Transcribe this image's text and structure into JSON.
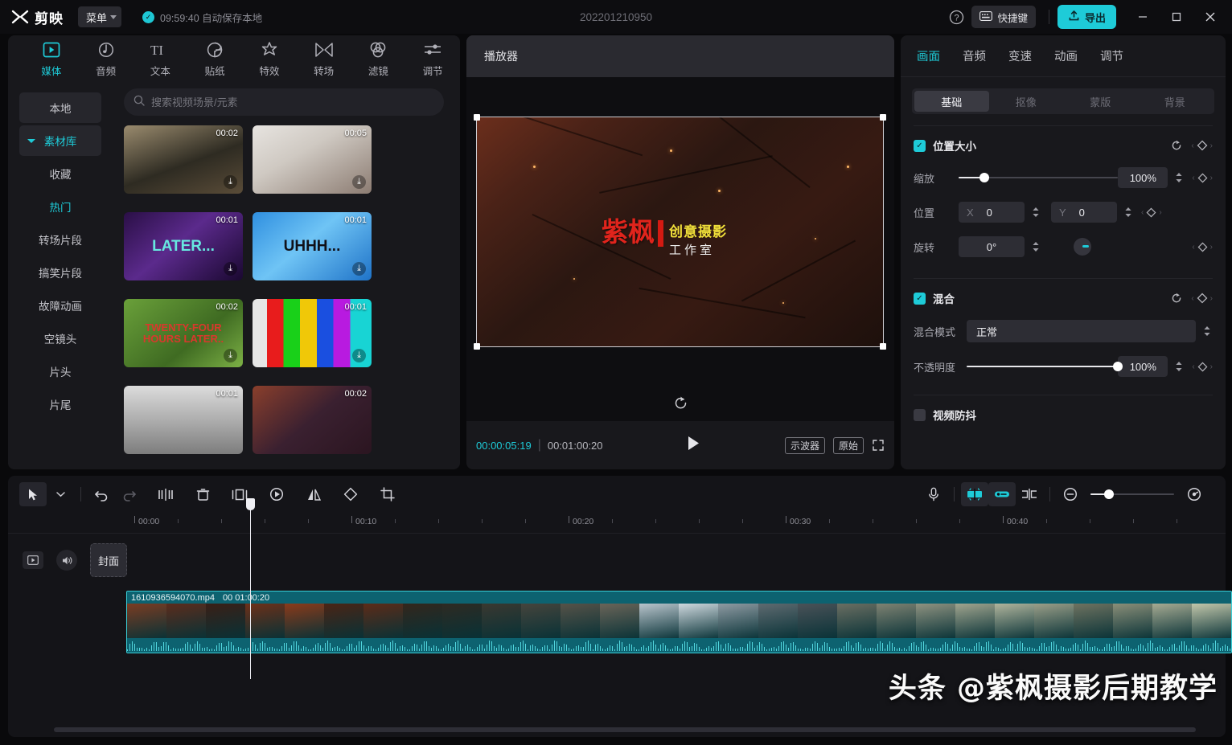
{
  "titlebar": {
    "app_name": "剪映",
    "menu_label": "菜单",
    "autosave_text": "09:59:40 自动保存本地",
    "project_title": "202201210950",
    "help_icon": "question-circle-icon",
    "shortcut_label": "快捷键",
    "export_label": "导出",
    "minimize": "—",
    "maximize": "□",
    "close": "✕",
    "accent_color": "#1ecbd8"
  },
  "left_panel": {
    "tabs": [
      {
        "label": "媒体",
        "icon": "media-icon",
        "active": true
      },
      {
        "label": "音频",
        "icon": "audio-icon",
        "active": false
      },
      {
        "label": "文本",
        "icon": "text-icon",
        "active": false
      },
      {
        "label": "贴纸",
        "icon": "sticker-icon",
        "active": false
      },
      {
        "label": "特效",
        "icon": "effects-icon",
        "active": false
      },
      {
        "label": "转场",
        "icon": "transition-icon",
        "active": false
      },
      {
        "label": "滤镜",
        "icon": "filter-icon",
        "active": false
      },
      {
        "label": "调节",
        "icon": "adjust-icon",
        "active": false
      }
    ],
    "sidebar": [
      {
        "label": "本地",
        "style": "box"
      },
      {
        "label": "素材库",
        "style": "box-accent-expanded"
      },
      {
        "label": "收藏",
        "style": "plain"
      },
      {
        "label": "热门",
        "style": "accent"
      },
      {
        "label": "转场片段",
        "style": "plain"
      },
      {
        "label": "搞笑片段",
        "style": "plain"
      },
      {
        "label": "故障动画",
        "style": "plain"
      },
      {
        "label": "空镜头",
        "style": "plain"
      },
      {
        "label": "片头",
        "style": "plain"
      },
      {
        "label": "片尾",
        "style": "plain"
      }
    ],
    "search_placeholder": "搜索视频场景/元素",
    "search_value": "",
    "search_icon": "search-icon",
    "thumbnails": [
      {
        "duration": "00:02",
        "caption": "",
        "bg": "linear-gradient(160deg,#9a8b6e,#2e2b22 55%,#5a4c38)"
      },
      {
        "duration": "00:05",
        "caption": "",
        "bg": "linear-gradient(150deg,#e7e4e0,#cfc9c2 40%,#8c7c72)"
      },
      {
        "duration": "00:01",
        "caption": "LATER...",
        "cap_color": "#67e8e0",
        "bg": "linear-gradient(140deg,#2a0f46,#5b2a8c 45%,#1a0830)"
      },
      {
        "duration": "00:01",
        "caption": "UHHH...",
        "cap_color": "#101018",
        "bg": "linear-gradient(140deg,#2f8fe0,#6fc4f5 45%,#1f73c8)"
      },
      {
        "duration": "00:02",
        "caption": "TWENTY-FOUR HOURS LATER..",
        "cap_color": "#d9382c",
        "bg": "linear-gradient(140deg,#6aa03a,#3f6b22 60%,#7cb045)"
      },
      {
        "duration": "00:01",
        "caption": "",
        "bg": "linear-gradient(90deg,#e6e6e6 0 12%,#e81c1c 12% 26%,#19d019 26% 40%,#f0c808 40% 54%,#1a4fe0 54% 68%,#b81ae0 68% 82%,#18d4d4 82% 100%)"
      },
      {
        "duration": "00:01",
        "caption": "",
        "bg": "linear-gradient(180deg,#dcdcdc,#a9a9a9 55%,#7d7d7d)"
      },
      {
        "duration": "00:02",
        "caption": "",
        "bg": "linear-gradient(140deg,#8a3f2c,#3a2030 50%,#2b1520)"
      }
    ]
  },
  "player": {
    "header": "播放器",
    "watermark_left": "紫枫",
    "watermark_line1": "创意摄影",
    "watermark_line2": "工作室",
    "watermark_left_color": "#e0241c",
    "watermark_line1_color": "#f1e03a",
    "reset_icon": "reset-rotate-icon",
    "current_time": "00:00:05:19",
    "total_time": "00:01:00:20",
    "play_icon": "play-icon",
    "scope_label": "示波器",
    "original_label": "原始",
    "fullscreen_icon": "fullscreen-icon"
  },
  "right_panel": {
    "tabs": [
      {
        "label": "画面",
        "active": true
      },
      {
        "label": "音频",
        "active": false
      },
      {
        "label": "变速",
        "active": false
      },
      {
        "label": "动画",
        "active": false
      },
      {
        "label": "调节",
        "active": false
      }
    ],
    "segments": [
      {
        "label": "基础",
        "active": true
      },
      {
        "label": "抠像",
        "active": false
      },
      {
        "label": "蒙版",
        "active": false
      },
      {
        "label": "背景",
        "active": false
      }
    ],
    "position_size": {
      "title": "位置大小",
      "checked": true,
      "reset_icon": "reset-icon",
      "keyframe_icon": "keyframe-diamond-icon",
      "scale_label": "缩放",
      "scale_value": "100%",
      "scale_percent": 16,
      "position_label": "位置",
      "pos_x_axis": "X",
      "pos_x_value": "0",
      "pos_y_axis": "Y",
      "pos_y_value": "0",
      "rotate_label": "旋转",
      "rotate_value": "0°"
    },
    "blend": {
      "title": "混合",
      "checked": true,
      "mode_label": "混合模式",
      "mode_value": "正常",
      "opacity_label": "不透明度",
      "opacity_value": "100%",
      "opacity_percent": 100
    },
    "stabilize": {
      "title": "视频防抖",
      "checked": false
    }
  },
  "timeline": {
    "tools": [
      {
        "name": "select-arrow-icon",
        "state": "normal"
      },
      {
        "name": "chevron-down-icon",
        "state": "normal"
      },
      {
        "name": "undo-icon",
        "state": "normal"
      },
      {
        "name": "redo-icon",
        "state": "dim"
      },
      {
        "name": "split-icon",
        "state": "normal"
      },
      {
        "name": "delete-icon",
        "state": "normal"
      },
      {
        "name": "freeze-frame-icon",
        "state": "normal"
      },
      {
        "name": "reverse-icon",
        "state": "normal"
      },
      {
        "name": "mirror-icon",
        "state": "normal"
      },
      {
        "name": "rotate-icon",
        "state": "normal"
      },
      {
        "name": "crop-icon",
        "state": "normal"
      }
    ],
    "right_tools": [
      {
        "name": "microphone-icon",
        "state": "normal"
      },
      {
        "name": "auto-snap-icon",
        "state": "on"
      },
      {
        "name": "link-icon",
        "state": "on"
      },
      {
        "name": "adjust-clip-icon",
        "state": "normal"
      },
      {
        "name": "zoom-out-icon",
        "state": "normal"
      },
      {
        "name": "zoom-in-icon",
        "state": "normal"
      }
    ],
    "zoom_percent": 22,
    "ruler_labels": [
      "00:00",
      "00:10",
      "00:20",
      "00:30",
      "00:40"
    ],
    "playhead_time": "00:00:05:19",
    "gutter": {
      "video_icon": "video-track-icon",
      "audio_icon": "volume-icon",
      "cover_label": "封面"
    },
    "clip": {
      "name": "1610936594070.mp4",
      "duration": "00 01:00:20",
      "color": "#0d6270"
    }
  },
  "overlay_watermark": "头条 @紫枫摄影后期教学"
}
